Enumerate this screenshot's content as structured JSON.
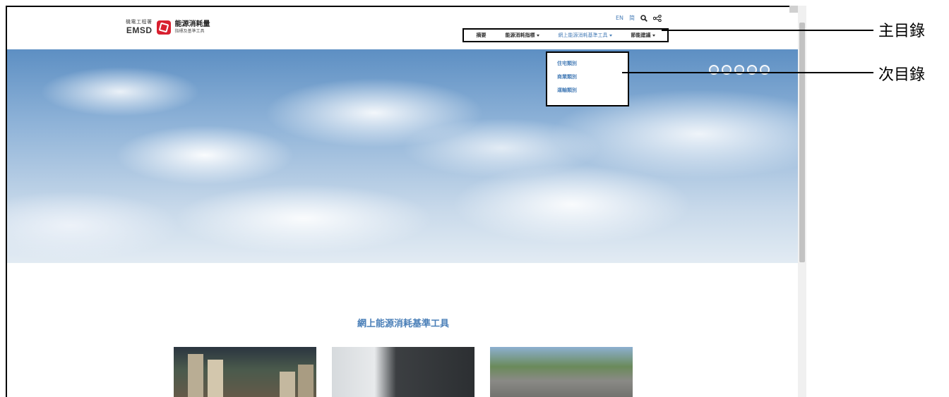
{
  "header": {
    "logo": {
      "dept_text": "機電工程署",
      "emsd_text": "EMSD",
      "title": "能源消耗量",
      "subtitle": "指標及基準工具"
    },
    "utility": {
      "lang_en": "EN",
      "lang_sc": "简",
      "search_icon": "search-icon",
      "share_icon": "share-icon"
    },
    "main_nav": [
      {
        "label": "摘要",
        "has_dropdown": false
      },
      {
        "label": "能源消耗指標",
        "has_dropdown": true
      },
      {
        "label": "網上能源消耗基準工具",
        "has_dropdown": true,
        "active": true
      },
      {
        "label": "節能建議",
        "has_dropdown": true
      }
    ]
  },
  "submenu": {
    "items": [
      "住宅類別",
      "商業類別",
      "運輸類別"
    ]
  },
  "section": {
    "title": "網上能源消耗基準工具"
  },
  "annotations": {
    "main_menu": "主目錄",
    "sub_menu": "次目錄"
  },
  "colors": {
    "accent": "#4a7fb8",
    "logo_red": "#d8202f"
  }
}
